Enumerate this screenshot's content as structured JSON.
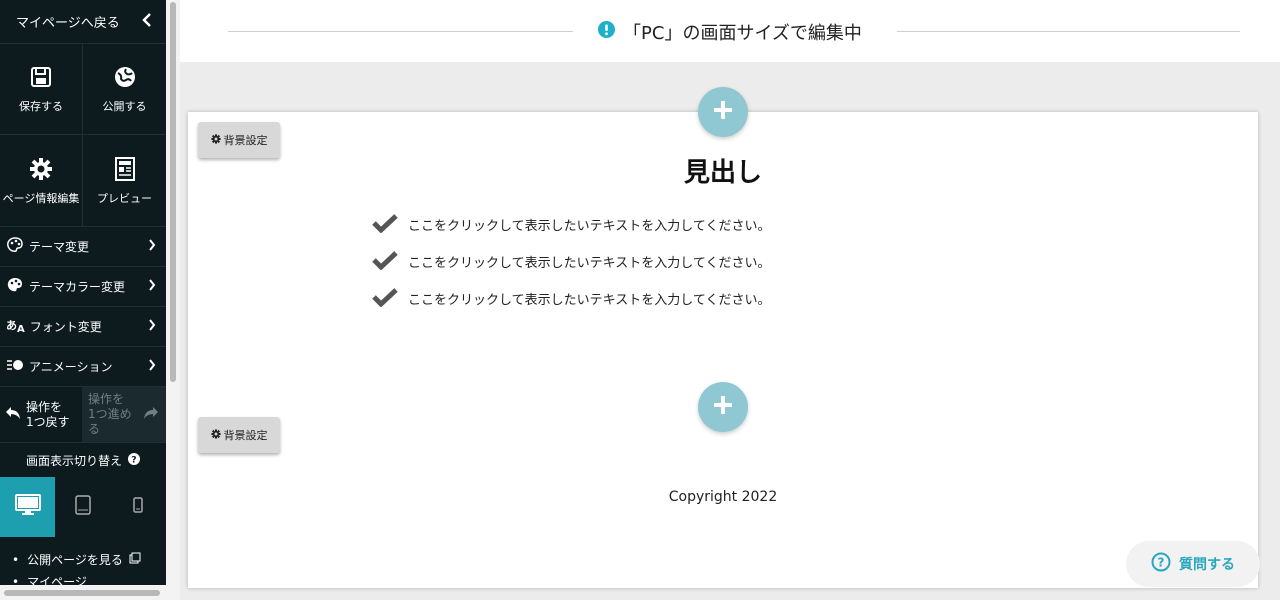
{
  "sidebar": {
    "back_label": "マイページへ戻る",
    "save_label": "保存する",
    "publish_label": "公開する",
    "page_info_label": "ページ情報編集",
    "preview_label": "プレビュー",
    "menu": {
      "theme": "テーマ変更",
      "theme_color": "テーマカラー変更",
      "font": "フォント変更",
      "animation": "アニメーション"
    },
    "undo_line1": "操作を",
    "undo_line2": "1つ戻す",
    "redo_line1": "操作を",
    "redo_line2": "1つ進める",
    "switch_title": "画面表示切り替え",
    "links": {
      "public_page": "公開ページを見る",
      "mypage": "マイページ"
    }
  },
  "topbar": {
    "message": "「PC」の画面サイズで編集中"
  },
  "canvas": {
    "bg_setting_label": "背景設定",
    "heading": "見出し",
    "checklist": [
      "ここをクリックして表示したいテキストを入力してください。",
      "ここをクリックして表示したいテキストを入力してください。",
      "ここをクリックして表示したいテキストを入力してください。"
    ],
    "copyright": "Copyright 2022"
  },
  "help": {
    "label": "質問する"
  },
  "colors": {
    "sidebar_bg": "#0d1b1f",
    "accent": "#1e9fb0",
    "add_button": "#8fc8d2",
    "help_text": "#2aa7c0"
  }
}
